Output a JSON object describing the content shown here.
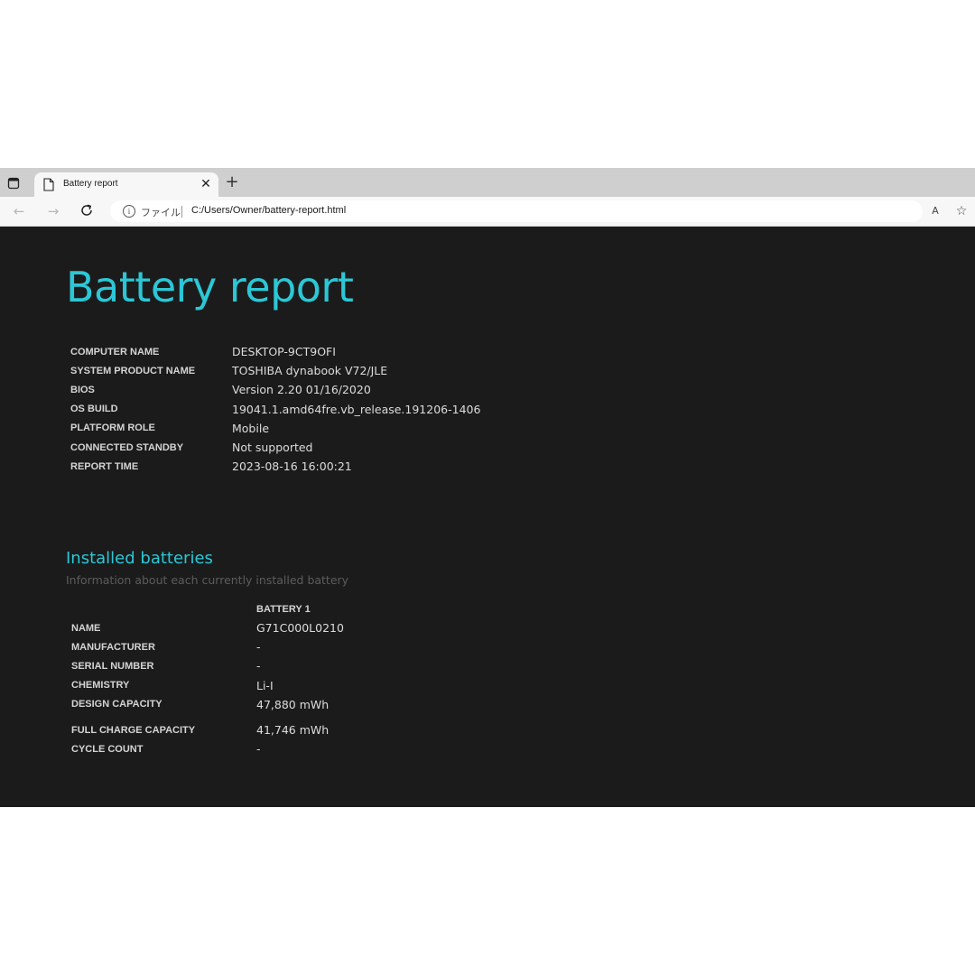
{
  "browser": {
    "tab": {
      "title": "Battery report"
    },
    "address": {
      "scheme_label": "ファイル",
      "url": "C:/Users/Owner/battery-report.html"
    },
    "toolbar": {
      "read_aloud_label": "A"
    }
  },
  "report": {
    "title": "Battery report",
    "system_info": [
      {
        "label": "COMPUTER NAME",
        "value": "DESKTOP-9CT9OFI"
      },
      {
        "label": "SYSTEM PRODUCT NAME",
        "value": "TOSHIBA dynabook V72/JLE"
      },
      {
        "label": "BIOS",
        "value": "Version 2.20 01/16/2020"
      },
      {
        "label": "OS BUILD",
        "value": "19041.1.amd64fre.vb_release.191206-1406"
      },
      {
        "label": "PLATFORM ROLE",
        "value": "Mobile"
      },
      {
        "label": "CONNECTED STANDBY",
        "value": "Not supported"
      },
      {
        "label": "REPORT TIME",
        "value": "2023-08-16  16:00:21"
      }
    ],
    "installed_batteries": {
      "title": "Installed batteries",
      "subtitle": "Information about each currently installed battery",
      "column_header": "BATTERY 1",
      "rows": [
        {
          "label": "NAME",
          "value": "G71C000L0210"
        },
        {
          "label": "MANUFACTURER",
          "value": "-"
        },
        {
          "label": "SERIAL NUMBER",
          "value": "-"
        },
        {
          "label": "CHEMISTRY",
          "value": "Li-I"
        },
        {
          "label": "DESIGN CAPACITY",
          "value": "47,880 mWh"
        },
        {
          "label": "FULL CHARGE CAPACITY",
          "value": "41,746 mWh"
        },
        {
          "label": "CYCLE COUNT",
          "value": "-"
        }
      ]
    }
  },
  "colors": {
    "accent": "#2cc7d6",
    "page_background": "#1b1b1b",
    "tabbar": "#cfcfcf",
    "toolbar": "#f7f7f7"
  }
}
